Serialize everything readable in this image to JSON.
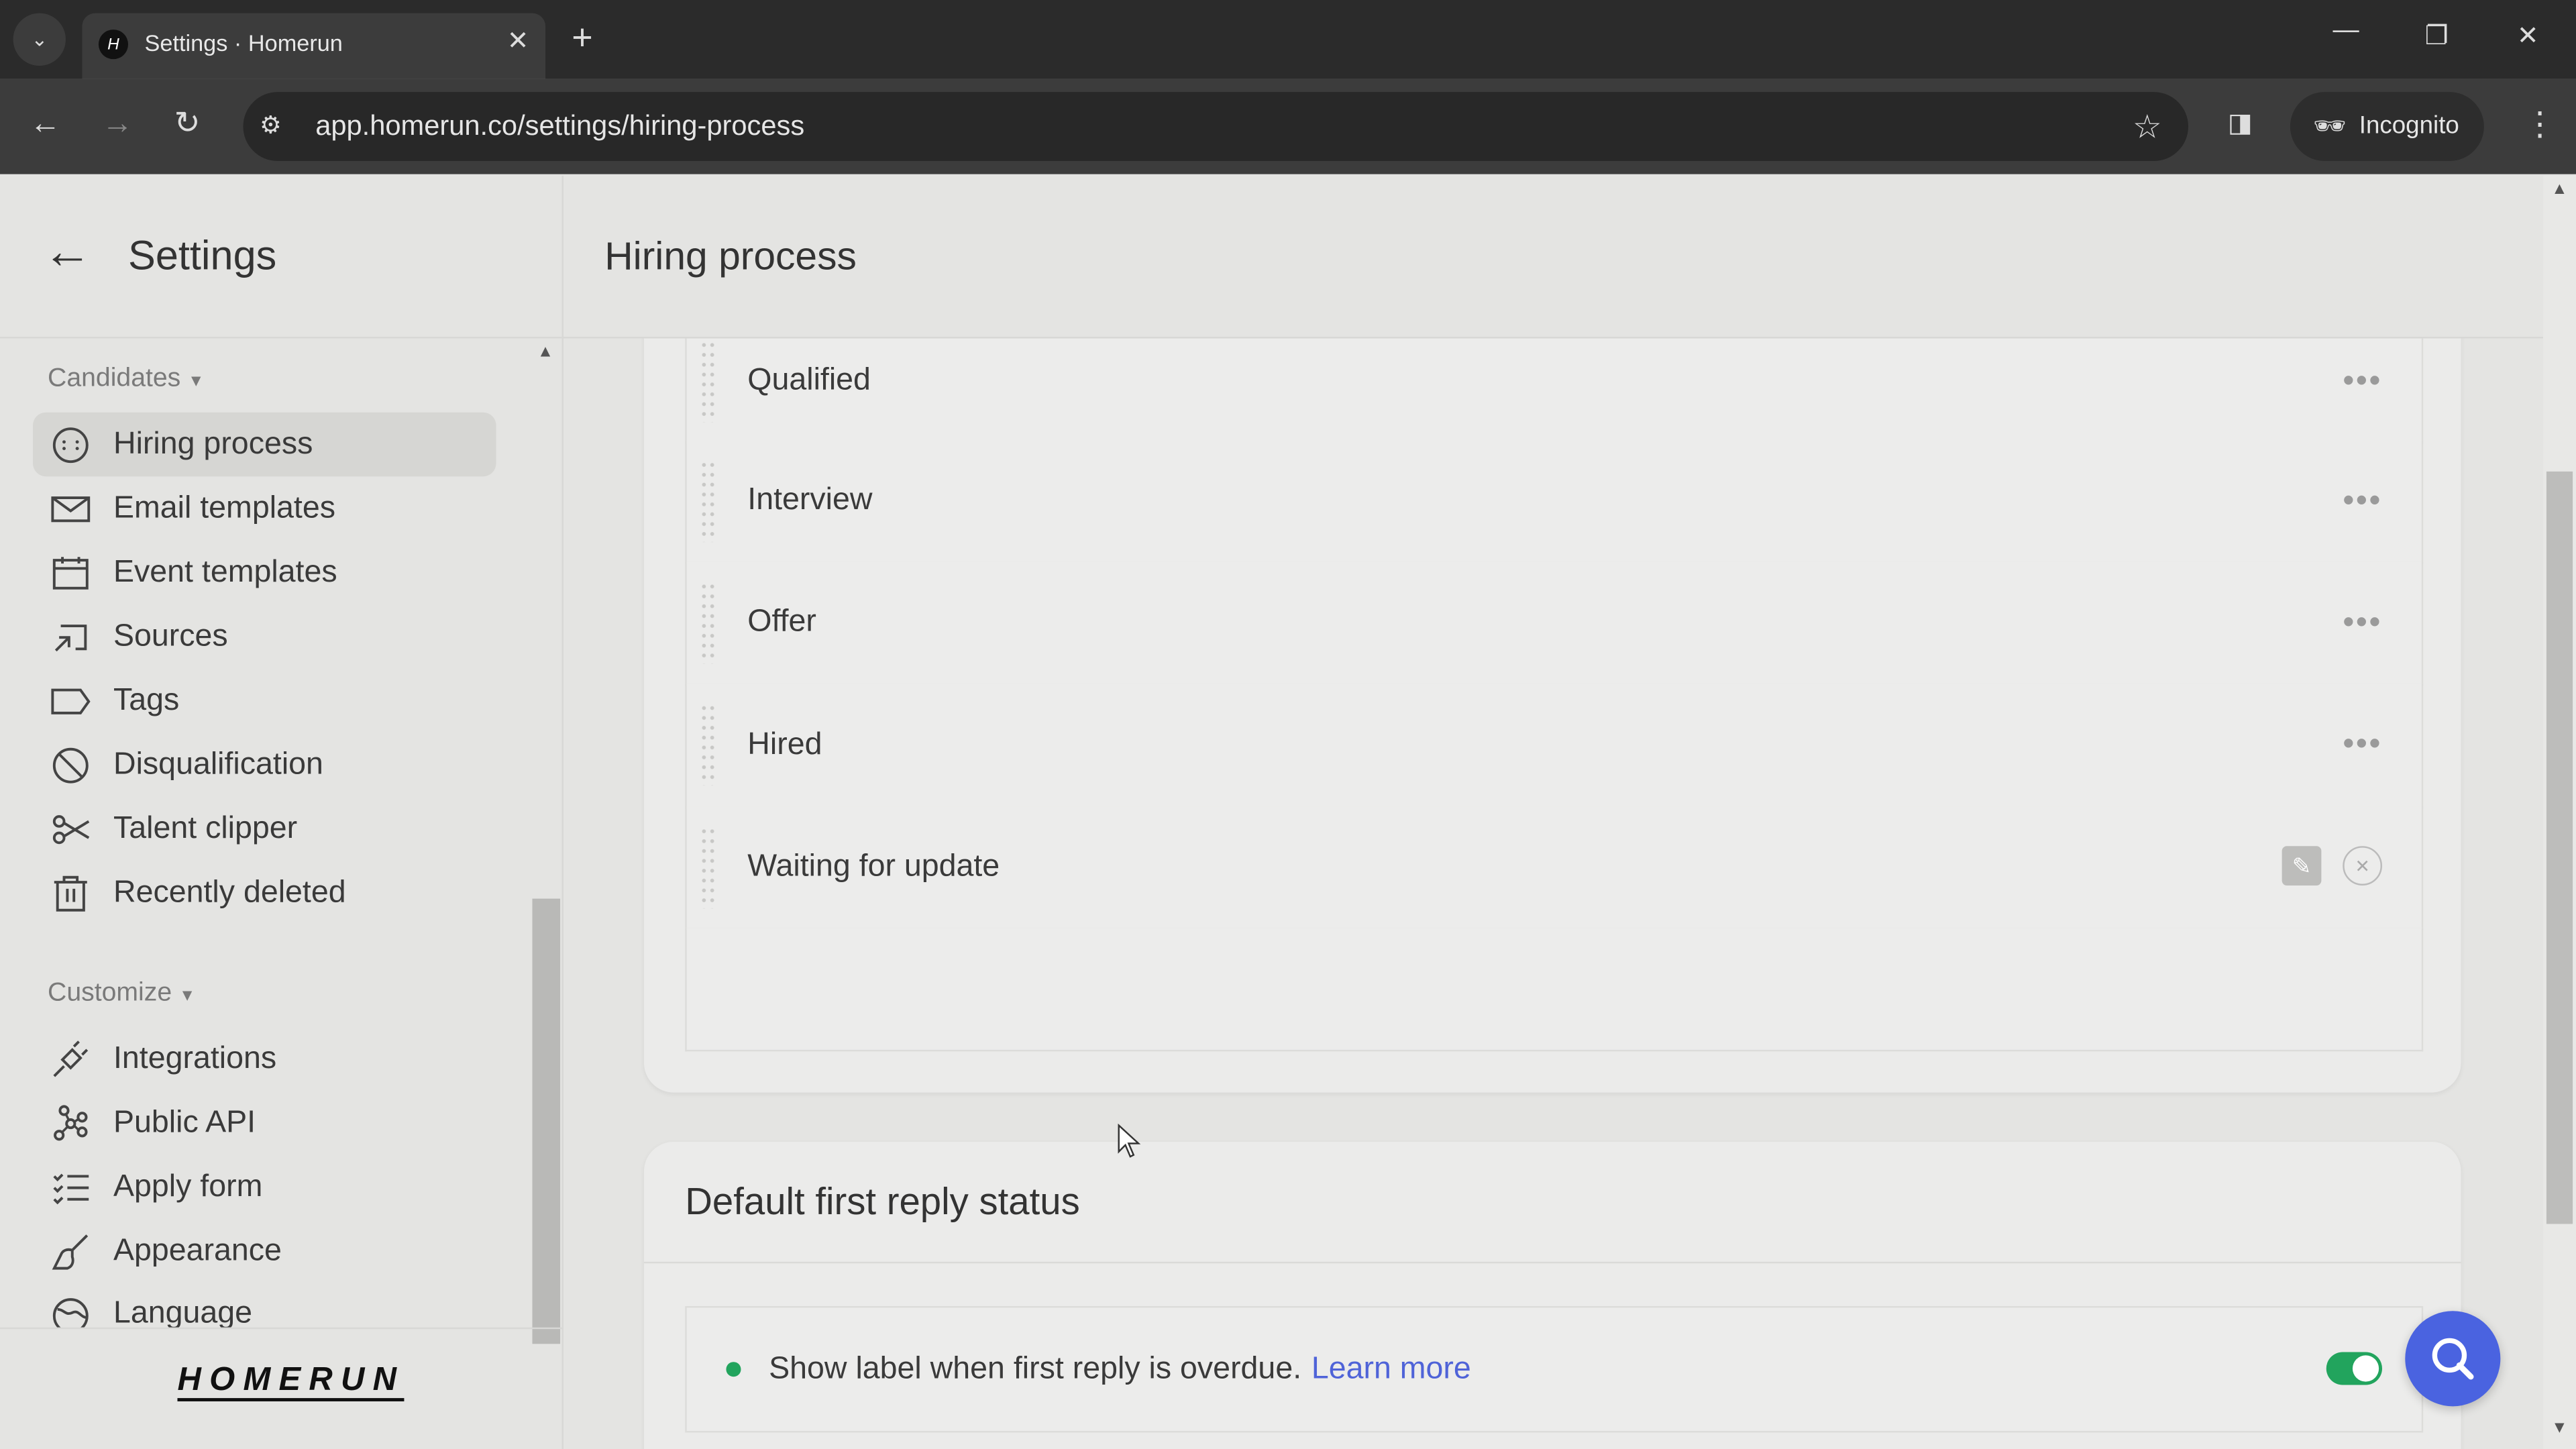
{
  "browser": {
    "tab_title": "Settings · Homerun",
    "url": "app.homerun.co/settings/hiring-process",
    "profile_label": "Incognito"
  },
  "sidebar": {
    "title": "Settings",
    "sections": [
      {
        "label": "Candidates",
        "items": [
          {
            "label": "Hiring process",
            "icon": "hiring-process-icon",
            "active": true
          },
          {
            "label": "Email templates",
            "icon": "envelope-icon"
          },
          {
            "label": "Event templates",
            "icon": "calendar-icon"
          },
          {
            "label": "Sources",
            "icon": "sources-icon"
          },
          {
            "label": "Tags",
            "icon": "tag-icon"
          },
          {
            "label": "Disqualification",
            "icon": "ban-icon"
          },
          {
            "label": "Talent clipper",
            "icon": "scissors-icon"
          },
          {
            "label": "Recently deleted",
            "icon": "trash-icon"
          }
        ]
      },
      {
        "label": "Customize",
        "items": [
          {
            "label": "Integrations",
            "icon": "plug-icon"
          },
          {
            "label": "Public API",
            "icon": "api-icon"
          },
          {
            "label": "Apply form",
            "icon": "checklist-icon"
          },
          {
            "label": "Appearance",
            "icon": "brush-icon"
          },
          {
            "label": "Language",
            "icon": "globe-icon"
          }
        ]
      }
    ],
    "logo": "HOMERUN"
  },
  "main": {
    "title": "Hiring process",
    "stages": [
      "Qualified",
      "Interview",
      "Offer",
      "Hired",
      "Waiting for update"
    ],
    "first_reply": {
      "title": "Default first reply status",
      "text": "Show label when first reply is overdue.",
      "link": "Learn more",
      "enabled": true
    }
  },
  "colors": {
    "accent": "#4a63e0",
    "toggle": "#22a45d",
    "link": "#4f63d8"
  }
}
